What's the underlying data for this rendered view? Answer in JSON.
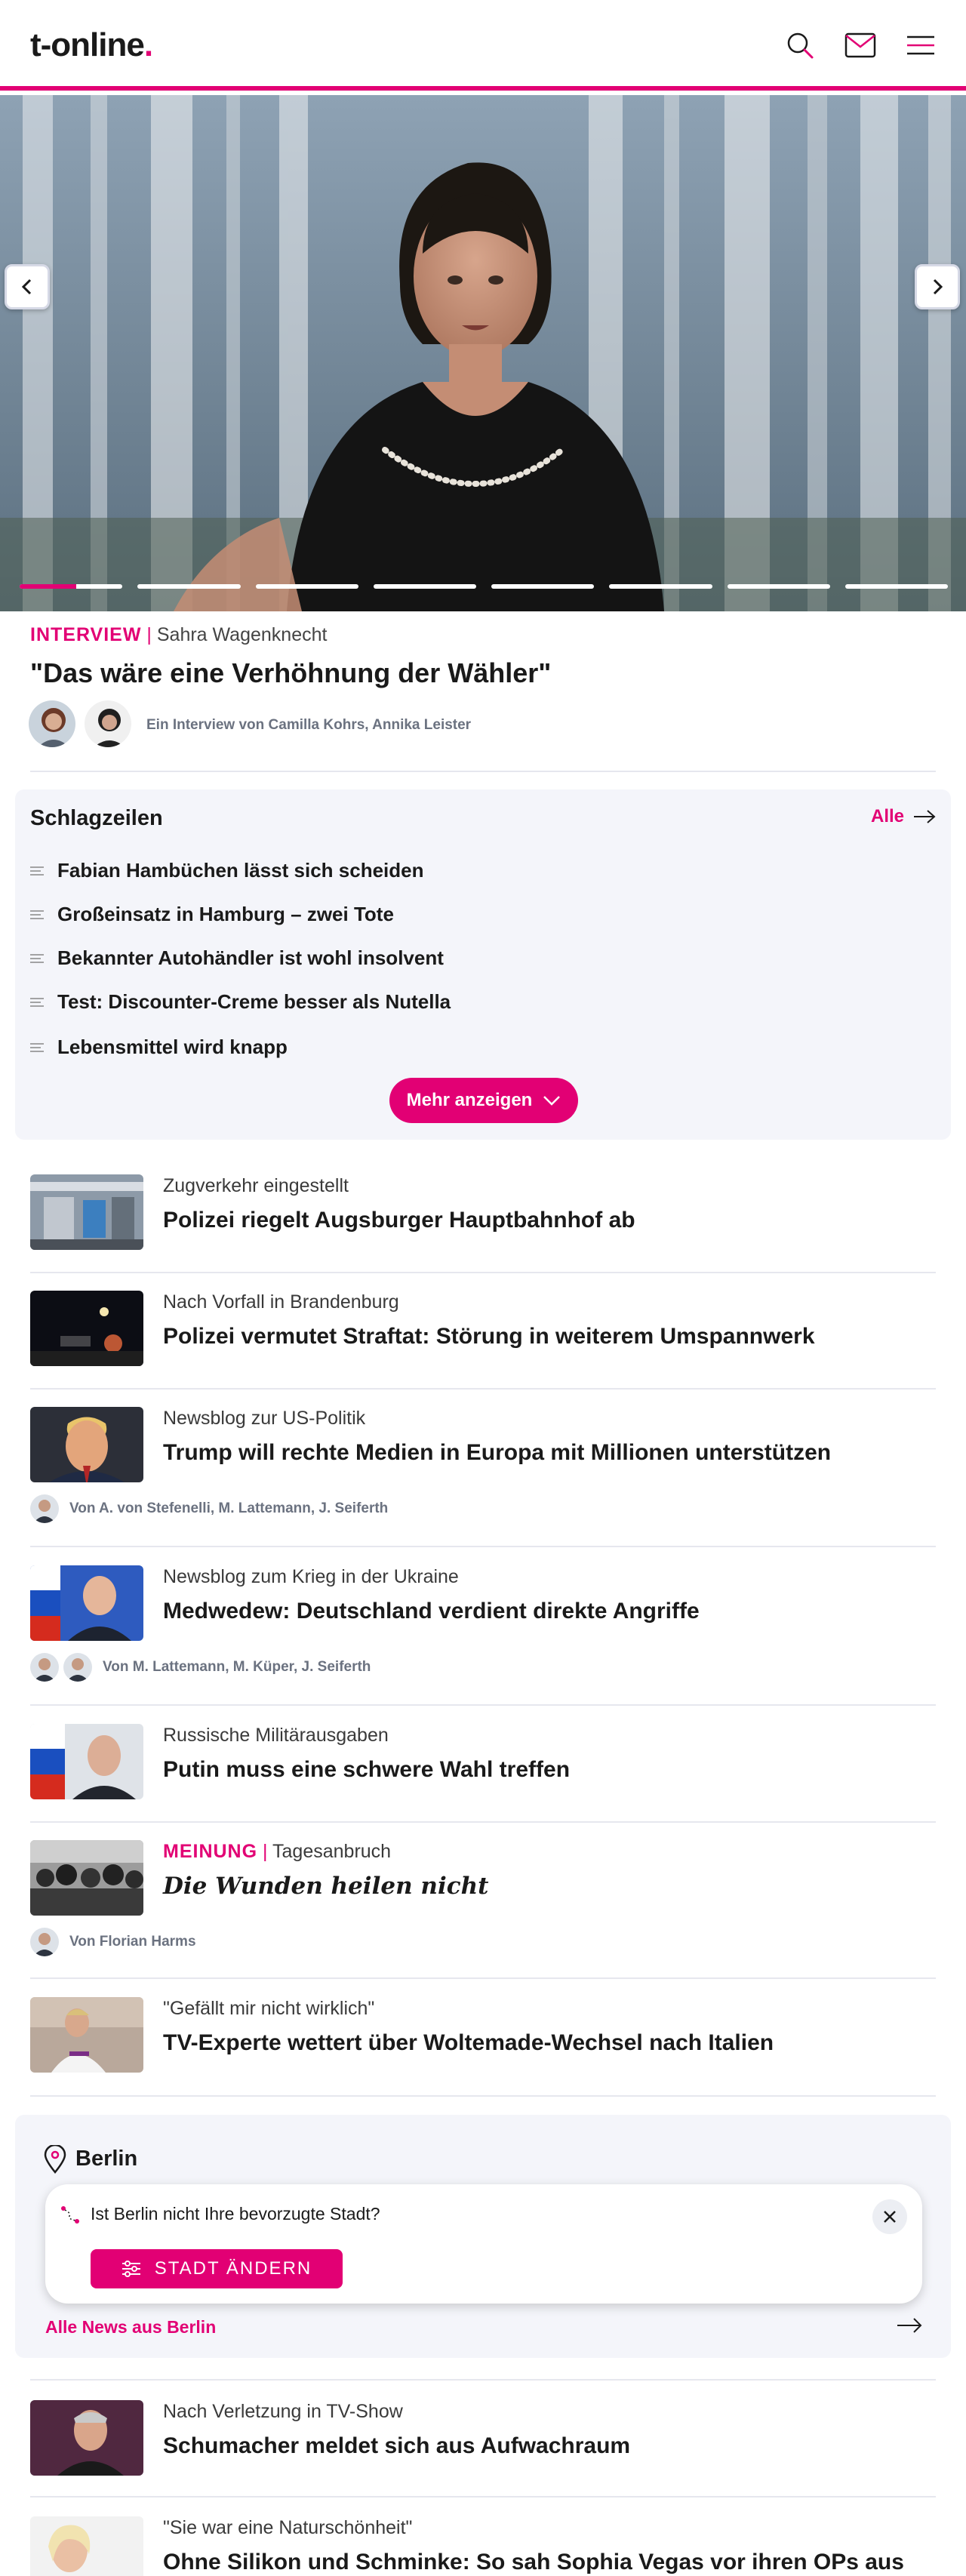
{
  "header": {
    "logo_text": "t-online",
    "logo_dot": ".",
    "icons": [
      "search-icon",
      "mail-icon",
      "menu-icon"
    ],
    "accent": "#e20074"
  },
  "hero": {
    "slide_count": 8,
    "active_slide": 1,
    "progress": 0.55,
    "kicker_label": "INTERVIEW",
    "kicker_sep": "|",
    "kicker_topic": "Sahra Wagenknecht",
    "title": "\"Das wäre eine Verhöhnung der Wähler\"",
    "byline": "Ein Interview von Camilla Kohrs, Annika Leister"
  },
  "headlines": {
    "title": "Schlagzeilen",
    "all_label": "Alle",
    "items": [
      "Fabian Hambüchen lässt sich scheiden",
      "Großeinsatz in Hamburg – zwei Tote",
      "Bekannter Autohändler ist wohl insolvent",
      "Test: Discounter-Creme besser als Nutella",
      "Lebensmittel wird knapp"
    ],
    "more_label": "Mehr anzeigen"
  },
  "articles": [
    {
      "kicker": "Zugverkehr eingestellt",
      "title": "Polizei riegelt Augsburger Hauptbahnhof ab"
    },
    {
      "kicker": "Nach Vorfall in Brandenburg",
      "title": "Polizei vermutet Straftat: Störung in weiterem Umspannwerk"
    },
    {
      "kicker": "Newsblog zur US-Politik",
      "title": "Trump will rechte Medien in Europa mit Millionen unterstützen",
      "byline": "Von A. von Stefenelli, M. Lattemann, J. Seiferth"
    },
    {
      "kicker": "Newsblog zum Krieg in der Ukraine",
      "title": "Medwedew: Deutschland verdient direkte Angriffe",
      "byline": "Von M. Lattemann, M. Küper, J. Seiferth"
    },
    {
      "kicker": "Russische Militärausgaben",
      "title": "Putin muss eine schwere Wahl treffen"
    },
    {
      "kicker_label": "MEINUNG",
      "kicker_sep": "|",
      "kicker": "Tagesanbruch",
      "title": "Die Wunden heilen nicht",
      "byline": "Von Florian Harms"
    },
    {
      "kicker": "\"Gefällt mir nicht wirklich\"",
      "title": "TV-Experte wettert über Woltemade-Wechsel nach Italien"
    }
  ],
  "berlin": {
    "title": "Berlin",
    "prompt": "Ist Berlin nicht Ihre bevorzugte Stadt?",
    "button": "STADT ÄNDERN",
    "link": "Alle News aus Berlin"
  },
  "more_articles": [
    {
      "kicker": "Nach Verletzung in TV-Show",
      "title": "Schumacher meldet sich aus Aufwachraum"
    },
    {
      "kicker": "\"Sie war eine Naturschönheit\"",
      "title": "Ohne Silikon und Schminke: So sah Sophia Vegas vor ihren OPs aus"
    }
  ]
}
